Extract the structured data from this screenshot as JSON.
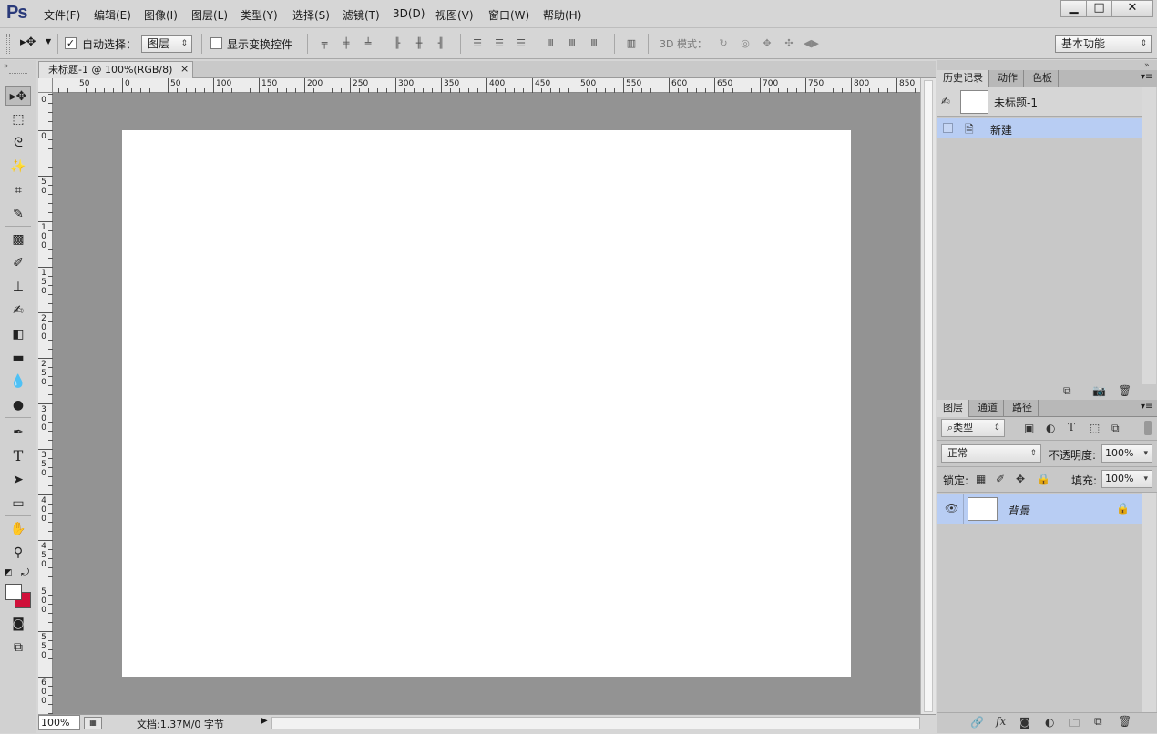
{
  "app": {
    "logo": "Ps",
    "min": "▁",
    "max": "□",
    "close": "✕"
  },
  "menu": [
    "文件(F)",
    "编辑(E)",
    "图像(I)",
    "图层(L)",
    "类型(Y)",
    "选择(S)",
    "滤镜(T)",
    "3D(D)",
    "视图(V)",
    "窗口(W)",
    "帮助(H)"
  ],
  "options": {
    "auto_select_label": "自动选择：",
    "auto_select_checked": "✓",
    "layer_dropdown": "图层",
    "show_transform_label": "显示变换控件",
    "mode3d_label": "3D 模式：",
    "workspace": "基本功能"
  },
  "document": {
    "tab_title": "未标题-1 @ 100%(RGB/8)",
    "tab_close": "×",
    "zoom": "100%",
    "status": "文档:1.37M/0 字节"
  },
  "ruler": {
    "h_labels": [
      "50",
      "0",
      "50",
      "100",
      "150",
      "200",
      "250",
      "300",
      "350",
      "400",
      "450",
      "500",
      "550",
      "600",
      "650",
      "700",
      "750",
      "800",
      "850"
    ],
    "v_labels": [
      [
        "0"
      ],
      [
        "0"
      ],
      [
        "5",
        "0"
      ],
      [
        "1",
        "0",
        "0"
      ],
      [
        "1",
        "5",
        "0"
      ],
      [
        "2",
        "0",
        "0"
      ],
      [
        "2",
        "5",
        "0"
      ],
      [
        "3",
        "0",
        "0"
      ],
      [
        "3",
        "5",
        "0"
      ],
      [
        "4",
        "0",
        "0"
      ],
      [
        "4",
        "5",
        "0"
      ],
      [
        "5",
        "0",
        "0"
      ],
      [
        "5",
        "5",
        "0"
      ],
      [
        "6",
        "0",
        "0"
      ]
    ]
  },
  "history_panel": {
    "tabs": [
      "历史记录",
      "动作",
      "色板"
    ],
    "snapshot_label": "未标题-1",
    "items": [
      {
        "label": "新建"
      }
    ]
  },
  "layers_panel": {
    "tabs": [
      "图层",
      "通道",
      "路径"
    ],
    "filter_kind": "类型",
    "blend_mode": "正常",
    "opacity_label": "不透明度:",
    "opacity_value": "100%",
    "lock_label": "锁定:",
    "fill_label": "填充:",
    "fill_value": "100%",
    "layers": [
      {
        "name": "背景"
      }
    ]
  }
}
